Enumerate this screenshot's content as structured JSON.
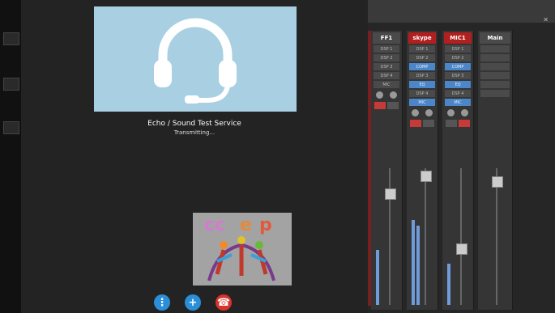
{
  "call": {
    "contact_name": "Echo / Sound Test Service",
    "status": "Transmitting..."
  },
  "controls": {
    "dialpad_icon": "dialpad-icon",
    "add_icon": "add-icon",
    "hangup_icon": "hang-up-icon",
    "dialpad_color": "#2a8fd8",
    "add_color": "#2a8fd8",
    "hangup_color": "#d9332c"
  },
  "selfview": {
    "logo_text": "CCEP"
  },
  "mixer": {
    "channels": [
      {
        "name": "FF1",
        "color": "#4a4a4a"
      },
      {
        "name": "skype",
        "color": "#b21f1f"
      },
      {
        "name": "MIC1",
        "color": "#b21f1f"
      },
      {
        "name": "Main",
        "color": "#4a4a4a"
      }
    ],
    "slots": [
      "DSP 1",
      "DSP 2",
      "COMP",
      "DSP 3",
      "EQ",
      "DSP 4",
      "MIC"
    ]
  }
}
